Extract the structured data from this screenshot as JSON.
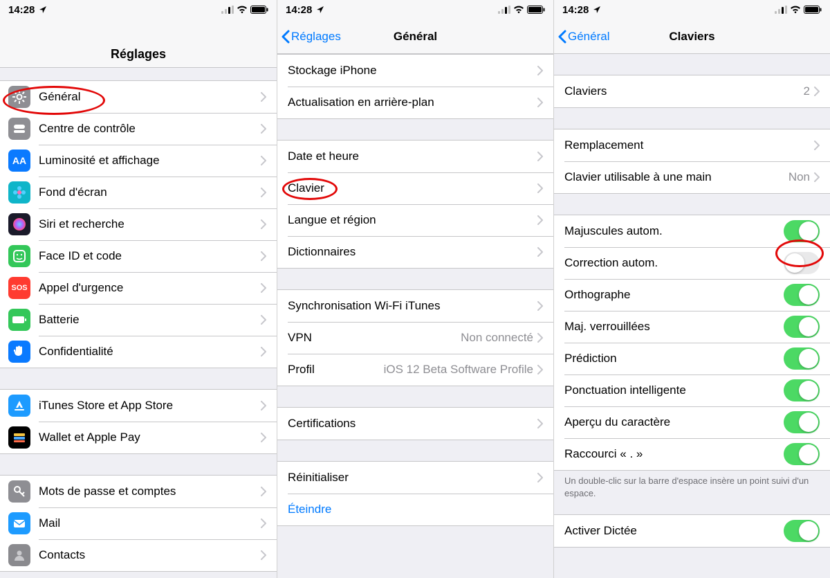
{
  "status": {
    "time": "14:28"
  },
  "screen1": {
    "title": "Réglages",
    "groups": [
      [
        {
          "label": "Général",
          "icon": "gear",
          "bg": "#8e8e93"
        },
        {
          "label": "Centre de contrôle",
          "icon": "switch",
          "bg": "#8e8e93"
        },
        {
          "label": "Luminosité et affichage",
          "icon": "AA",
          "bg": "#0a7aff"
        },
        {
          "label": "Fond d'écran",
          "icon": "flower",
          "bg": "#0fb5c9"
        },
        {
          "label": "Siri et recherche",
          "icon": "siri",
          "bg": "#1a1a2a"
        },
        {
          "label": "Face ID et code",
          "icon": "face",
          "bg": "#33c759"
        },
        {
          "label": "Appel d'urgence",
          "icon": "SOS",
          "bg": "#ff3b30"
        },
        {
          "label": "Batterie",
          "icon": "battery",
          "bg": "#33c759"
        },
        {
          "label": "Confidentialité",
          "icon": "hand",
          "bg": "#0a7aff"
        }
      ],
      [
        {
          "label": "iTunes Store et App Store",
          "icon": "A-store",
          "bg": "#1d9bff"
        },
        {
          "label": "Wallet et Apple Pay",
          "icon": "wallet",
          "bg": "#000000"
        }
      ],
      [
        {
          "label": "Mots de passe et comptes",
          "icon": "key",
          "bg": "#8e8e93"
        },
        {
          "label": "Mail",
          "icon": "mail",
          "bg": "#1d9bff"
        },
        {
          "label": "Contacts",
          "icon": "contacts",
          "bg": "#8a8a8e"
        }
      ]
    ]
  },
  "screen2": {
    "back": "Réglages",
    "title": "Général",
    "groups": [
      [
        {
          "label": "Stockage iPhone"
        },
        {
          "label": "Actualisation en arrière-plan"
        }
      ],
      [
        {
          "label": "Date et heure"
        },
        {
          "label": "Clavier"
        },
        {
          "label": "Langue et région"
        },
        {
          "label": "Dictionnaires"
        }
      ],
      [
        {
          "label": "Synchronisation Wi-Fi iTunes"
        },
        {
          "label": "VPN",
          "value": "Non connecté"
        },
        {
          "label": "Profil",
          "value": "iOS 12 Beta Software Profile"
        }
      ],
      [
        {
          "label": "Certifications"
        }
      ],
      [
        {
          "label": "Réinitialiser"
        },
        {
          "label": "Éteindre",
          "link": true,
          "noChevron": true
        }
      ]
    ]
  },
  "screen3": {
    "back": "Général",
    "title": "Claviers",
    "groups": [
      [
        {
          "label": "Claviers",
          "value": "2"
        }
      ],
      [
        {
          "label": "Remplacement"
        },
        {
          "label": "Clavier utilisable à une main",
          "value": "Non"
        }
      ],
      [
        {
          "label": "Majuscules autom.",
          "toggle": true,
          "on": true
        },
        {
          "label": "Correction autom.",
          "toggle": true,
          "on": false
        },
        {
          "label": "Orthographe",
          "toggle": true,
          "on": true
        },
        {
          "label": "Maj. verrouillées",
          "toggle": true,
          "on": true
        },
        {
          "label": "Prédiction",
          "toggle": true,
          "on": true
        },
        {
          "label": "Ponctuation intelligente",
          "toggle": true,
          "on": true
        },
        {
          "label": "Aperçu du caractère",
          "toggle": true,
          "on": true
        },
        {
          "label": "Raccourci « . »",
          "toggle": true,
          "on": true
        }
      ],
      [
        {
          "label": "Activer Dictée",
          "toggle": true,
          "on": true
        }
      ]
    ],
    "footer_after_group": 2,
    "footer": "Un double-clic sur la barre d'espace insère un point suivi d'un espace."
  }
}
